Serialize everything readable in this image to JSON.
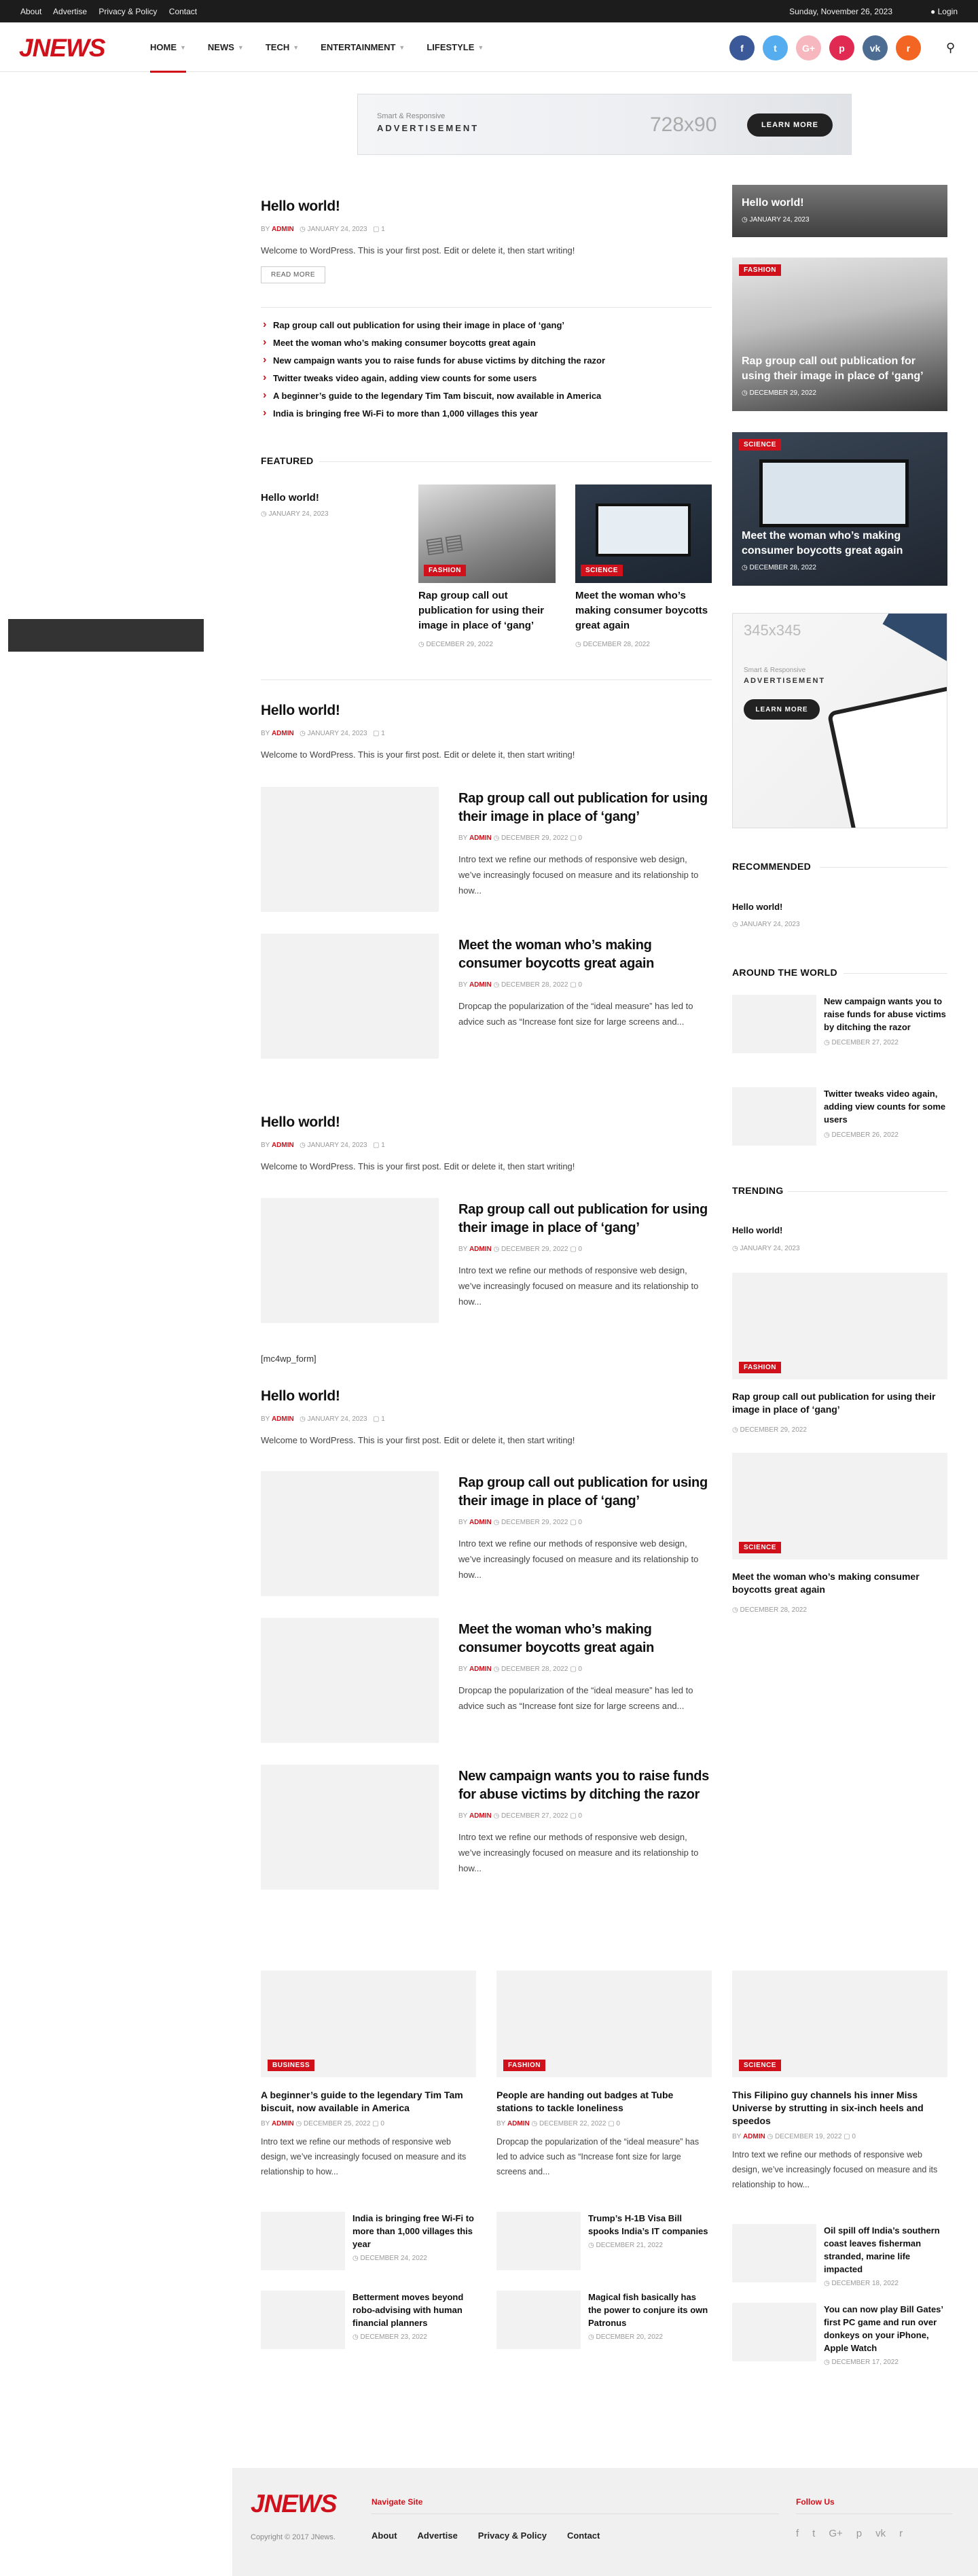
{
  "topbar": {
    "links": [
      "About",
      "Advertise",
      "Privacy & Policy",
      "Contact"
    ],
    "date": "Sunday, November 26, 2023",
    "login": "Login"
  },
  "header": {
    "logo": "JNEWS",
    "nav": [
      {
        "label": "HOME"
      },
      {
        "label": "NEWS"
      },
      {
        "label": "TECH"
      },
      {
        "label": "ENTERTAINMENT"
      },
      {
        "label": "LIFESTYLE"
      }
    ],
    "socials": [
      {
        "icon": "facebook-icon",
        "glyph": "f",
        "color": "#3b5998"
      },
      {
        "icon": "twitter-icon",
        "glyph": "t",
        "color": "#55acee"
      },
      {
        "icon": "google-plus-icon",
        "glyph": "G+",
        "color": "#f7b7bf"
      },
      {
        "icon": "pinterest-icon",
        "glyph": "p",
        "color": "#e02a52"
      },
      {
        "icon": "vk-icon",
        "glyph": "vk",
        "color": "#4c6c91"
      },
      {
        "icon": "rss-icon",
        "glyph": "r",
        "color": "#f26522"
      }
    ]
  },
  "ad_top": {
    "tag": "Smart & Responsive",
    "label": "ADVERTISEMENT",
    "size": "728x90",
    "button": "LEARN MORE"
  },
  "block1": {
    "title": "Hello world!",
    "by": "BY",
    "author": "ADMIN",
    "date": "JANUARY 24, 2023",
    "comments": "1",
    "excerpt": "Welcome to WordPress. This is your first post. Edit or delete it, then start writing!",
    "readmore": "READ MORE",
    "related": [
      "Rap group call out publication for using their image in place of ‘gang’",
      "Meet the woman who’s making consumer boycotts great again",
      "New campaign wants you to raise funds for abuse victims by ditching the razor",
      "Twitter tweaks video again, adding view counts for some users",
      "A beginner’s guide to the legendary Tim Tam biscuit, now available in America",
      "India is bringing free Wi-Fi to more than 1,000 villages this year"
    ]
  },
  "featured": {
    "title": "FEATURED",
    "main": {
      "title": "Hello world!",
      "date": "JANUARY 24, 2023"
    },
    "cards": [
      {
        "cat": "FASHION",
        "title": "Rap group call out publication for using their image in place of ‘gang’",
        "date": "DECEMBER 29, 2022"
      },
      {
        "cat": "SCIENCE",
        "title": "Meet the woman who’s making consumer boycotts great again",
        "date": "DECEMBER 28, 2022"
      }
    ]
  },
  "block2": {
    "title": "Hello world!",
    "author": "ADMIN",
    "date": "JANUARY 24, 2023",
    "comments": "1",
    "excerpt": "Welcome to WordPress. This is your first post. Edit or delete it, then start writing!",
    "items": [
      {
        "title": "Rap group call out publication for using their image in place of ‘gang’",
        "author": "ADMIN",
        "date": "DECEMBER 29, 2022",
        "comments": "0",
        "excerpt": "Intro text we refine our methods of responsive web design, we’ve increasingly focused on measure and its relationship to how..."
      },
      {
        "title": "Meet the woman who’s making consumer boycotts great again",
        "author": "ADMIN",
        "date": "DECEMBER 28, 2022",
        "comments": "0",
        "excerpt": "Dropcap the popularization of the “ideal measure” has led to advice such as “Increase font size for large screens and..."
      }
    ]
  },
  "block3": {
    "title": "Hello world!",
    "author": "ADMIN",
    "date": "JANUARY 24, 2023",
    "comments": "1",
    "excerpt": "Welcome to WordPress. This is your first post. Edit or delete it, then start writing!",
    "items": [
      {
        "title": "Rap group call out publication for using their image in place of ‘gang’",
        "author": "ADMIN",
        "date": "DECEMBER 29, 2022",
        "comments": "0",
        "excerpt": "Intro text we refine our methods of responsive web design, we’ve increasingly focused on measure and its relationship to how..."
      }
    ]
  },
  "shortcode": "[mc4wp_form]",
  "block4": {
    "title": "Hello world!",
    "author": "ADMIN",
    "date": "JANUARY 24, 2023",
    "comments": "1",
    "excerpt": "Welcome to WordPress. This is your first post. Edit or delete it, then start writing!",
    "items": [
      {
        "title": "Rap group call out publication for using their image in place of ‘gang’",
        "author": "ADMIN",
        "date": "DECEMBER 29, 2022",
        "comments": "0",
        "excerpt": "Intro text we refine our methods of responsive web design, we’ve increasingly focused on measure and its relationship to how..."
      },
      {
        "title": "Meet the woman who’s making consumer boycotts great again",
        "author": "ADMIN",
        "date": "DECEMBER 28, 2022",
        "comments": "0",
        "excerpt": "Dropcap the popularization of the “ideal measure” has led to advice such as “Increase font size for large screens and..."
      },
      {
        "title": "New campaign wants you to raise funds for abuse victims by ditching the razor",
        "author": "ADMIN",
        "date": "DECEMBER 27, 2022",
        "comments": "0",
        "excerpt": "Intro text we refine our methods of responsive web design, we’ve increasingly focused on measure and its relationship to how..."
      }
    ]
  },
  "sidebar": {
    "hero": [
      {
        "title": "Hello world!",
        "date": "JANUARY 24, 2023",
        "cat": ""
      },
      {
        "title": "Rap group call out publication for using their image in place of ‘gang’",
        "date": "DECEMBER 29, 2022",
        "cat": "FASHION"
      },
      {
        "title": "Meet the woman who’s making consumer boycotts great again",
        "date": "DECEMBER 28, 2022",
        "cat": "SCIENCE"
      }
    ],
    "ad": {
      "size": "345x345",
      "tag": "Smart & Responsive",
      "label": "ADVERTISEMENT",
      "button": "LEARN MORE"
    },
    "recommended": {
      "title": "RECOMMENDED",
      "post": "Hello world!",
      "date": "JANUARY 24, 2023"
    },
    "around": {
      "title": "AROUND THE WORLD",
      "items": [
        {
          "title": "New campaign wants you to raise funds for abuse victims by ditching the razor",
          "date": "DECEMBER 27, 2022"
        },
        {
          "title": "Twitter tweaks video again, adding view counts for some users",
          "date": "DECEMBER 26, 2022"
        }
      ]
    },
    "trending": {
      "title": "TRENDING",
      "post": "Hello world!",
      "date": "JANUARY 24, 2023",
      "cards": [
        {
          "cat": "FASHION",
          "title": "Rap group call out publication for using their image in place of ‘gang’",
          "date": "DECEMBER 29, 2022"
        },
        {
          "cat": "SCIENCE",
          "title": "Meet the woman who’s making consumer boycotts great again",
          "date": "DECEMBER 28, 2022"
        }
      ]
    }
  },
  "bottom": {
    "columns": [
      {
        "cat": "BUSINESS",
        "title": "A beginner’s guide to the legendary Tim Tam biscuit, now available in America",
        "author": "ADMIN",
        "date": "DECEMBER 25, 2022",
        "comments": "0",
        "excerpt": "Intro text we refine our methods of responsive web design, we’ve increasingly focused on measure and its relationship to how...",
        "small": [
          {
            "title": "India is bringing free Wi-Fi to more than 1,000 villages this year",
            "date": "DECEMBER 24, 2022"
          },
          {
            "title": "Betterment moves beyond robo-advising with human financial planners",
            "date": "DECEMBER 23, 2022"
          }
        ]
      },
      {
        "cat": "FASHION",
        "title": "People are handing out badges at Tube stations to tackle loneliness",
        "author": "ADMIN",
        "date": "DECEMBER 22, 2022",
        "comments": "0",
        "excerpt": "Dropcap the popularization of the “ideal measure” has led to advice such as “Increase font size for large screens and...",
        "small": [
          {
            "title": "Trump’s H-1B Visa Bill spooks India’s IT companies",
            "date": "DECEMBER 21, 2022"
          },
          {
            "title": "Magical fish basically has the power to conjure its own Patronus",
            "date": "DECEMBER 20, 2022"
          }
        ]
      },
      {
        "cat": "SCIENCE",
        "title": "This Filipino guy channels his inner Miss Universe by strutting in six-inch heels and speedos",
        "author": "ADMIN",
        "date": "DECEMBER 19, 2022",
        "comments": "0",
        "excerpt": "Intro text we refine our methods of responsive web design, we’ve increasingly focused on measure and its relationship to how...",
        "small": [
          {
            "title": "Oil spill off India’s southern coast leaves fisherman stranded, marine life impacted",
            "date": "DECEMBER 18, 2022"
          },
          {
            "title": "You can now play Bill Gates’ first PC game and run over donkeys on your iPhone, Apple Watch",
            "date": "DECEMBER 17, 2022"
          }
        ]
      }
    ]
  },
  "footer": {
    "logo": "JNEWS",
    "copyright": "Copyright © 2017 JNews.",
    "nav_title": "Navigate Site",
    "nav": [
      "About",
      "Advertise",
      "Privacy & Policy",
      "Contact"
    ],
    "follow_title": "Follow Us",
    "follow_icons": [
      "f",
      "t",
      "G+",
      "p",
      "vk",
      "r"
    ]
  }
}
